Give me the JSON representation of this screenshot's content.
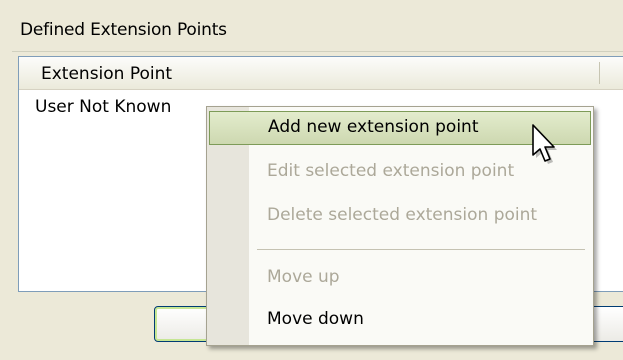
{
  "group": {
    "title": "Defined Extension Points"
  },
  "list": {
    "columns": [
      "Extension Point"
    ],
    "rows": [
      "User Not Known"
    ]
  },
  "context_menu": {
    "items": [
      {
        "label": "Add new extension point",
        "enabled": true,
        "hover": true
      },
      {
        "label": "Edit selected extension point",
        "enabled": false
      },
      {
        "label": "Delete selected extension point",
        "enabled": false
      },
      {
        "label": "Move up",
        "enabled": false
      },
      {
        "label": "Move down",
        "enabled": true
      }
    ]
  },
  "icons": {
    "cursor": "mouse-pointer-icon"
  },
  "colors": {
    "hover_border": "#7d9b58",
    "disabled_text": "#aca899",
    "window_bg": "#ece9d8"
  }
}
